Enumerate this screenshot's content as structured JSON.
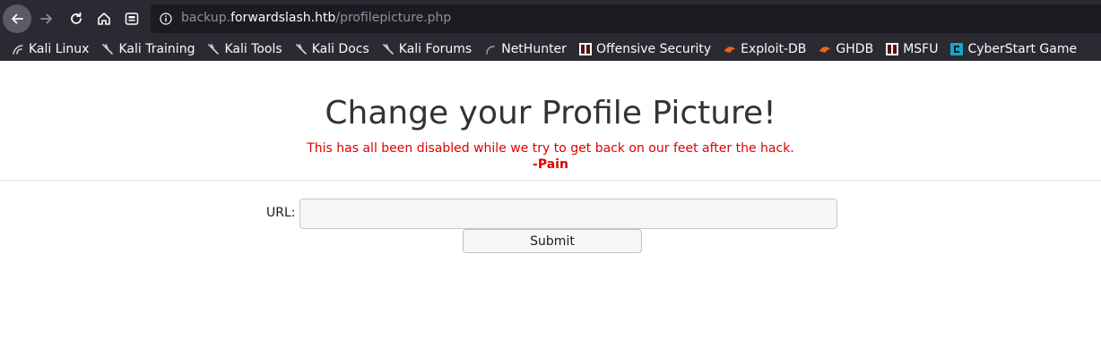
{
  "browser": {
    "url_prefix": "backup.",
    "url_domain": "forwardslash.htb",
    "url_path": "/profilepicture.php"
  },
  "bookmarks": [
    {
      "label": "Kali Linux",
      "icon": "kali-dragon-icon"
    },
    {
      "label": "Kali Training",
      "icon": "kali-dragon-icon"
    },
    {
      "label": "Kali Tools",
      "icon": "kali-dragon-icon"
    },
    {
      "label": "Kali Docs",
      "icon": "kali-dragon-icon"
    },
    {
      "label": "Kali Forums",
      "icon": "kali-dragon-icon"
    },
    {
      "label": "NetHunter",
      "icon": "nethunter-icon"
    },
    {
      "label": "Offensive Security",
      "icon": "offsec-icon"
    },
    {
      "label": "Exploit-DB",
      "icon": "exploitdb-icon"
    },
    {
      "label": "GHDB",
      "icon": "exploitdb-icon"
    },
    {
      "label": "MSFU",
      "icon": "offsec-icon"
    },
    {
      "label": "CyberStart Game",
      "icon": "cyberstart-icon"
    }
  ],
  "page": {
    "title": "Change your Profile Picture!",
    "notice": "This has all been disabled while we try to get back on our feet after the hack.",
    "signature": "-Pain"
  },
  "form": {
    "url_label": "URL:",
    "url_value": "",
    "submit_label": "Submit"
  },
  "colors": {
    "chrome_bg": "#2b2a33",
    "urlbar_bg": "#1c1b22",
    "notice_red": "#e00000",
    "title_gray": "#333333"
  }
}
